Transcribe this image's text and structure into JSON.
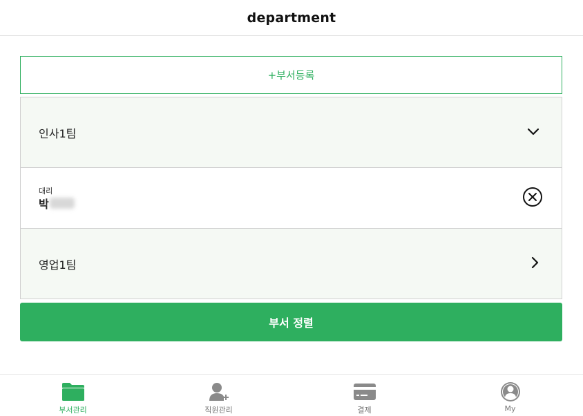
{
  "header": {
    "title": "department"
  },
  "add_button": {
    "label": "+부서등록"
  },
  "departments": [
    {
      "name": "인사1팀",
      "expanded": true,
      "members": [
        {
          "rank": "대리",
          "name": "박"
        }
      ]
    },
    {
      "name": "영업1팀",
      "expanded": false
    }
  ],
  "sort_button": {
    "label": "부서 정렬"
  },
  "bottom_nav": {
    "items": [
      {
        "label": "부서관리",
        "icon": "folder-icon",
        "active": true
      },
      {
        "label": "직원관리",
        "icon": "person-add-icon",
        "active": false
      },
      {
        "label": "결제",
        "icon": "credit-card-icon",
        "active": false
      },
      {
        "label": "My",
        "icon": "profile-icon",
        "active": false
      }
    ]
  },
  "colors": {
    "accent": "#2eaf5f",
    "row_background": "#f5f9f4",
    "border": "#d0d0d0",
    "nav_inactive": "#777777"
  }
}
